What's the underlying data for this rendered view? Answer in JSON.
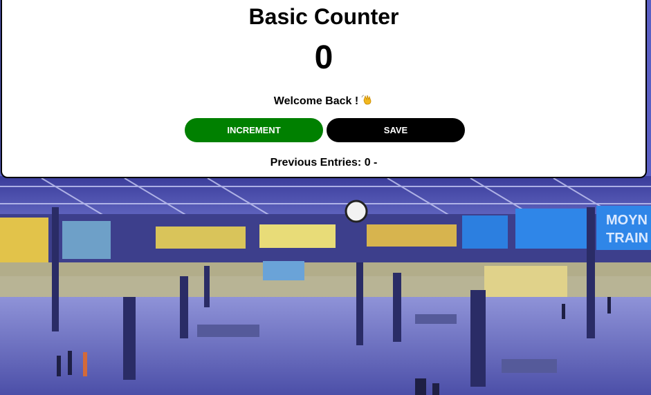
{
  "app": {
    "title": "Basic Counter",
    "count": "0",
    "welcome": "Welcome Back !",
    "wave_icon": "waving-hand-icon"
  },
  "buttons": {
    "increment_label": "INCREMENT",
    "save_label": "SAVE"
  },
  "entries": {
    "label": "Previous Entries: 0 -"
  },
  "background": {
    "signs": [
      "MOYN",
      "TRAIN"
    ]
  },
  "colors": {
    "increment": "#008000",
    "save": "#000000",
    "card": "#ffffff",
    "background_tint": "#5a5fc4"
  }
}
